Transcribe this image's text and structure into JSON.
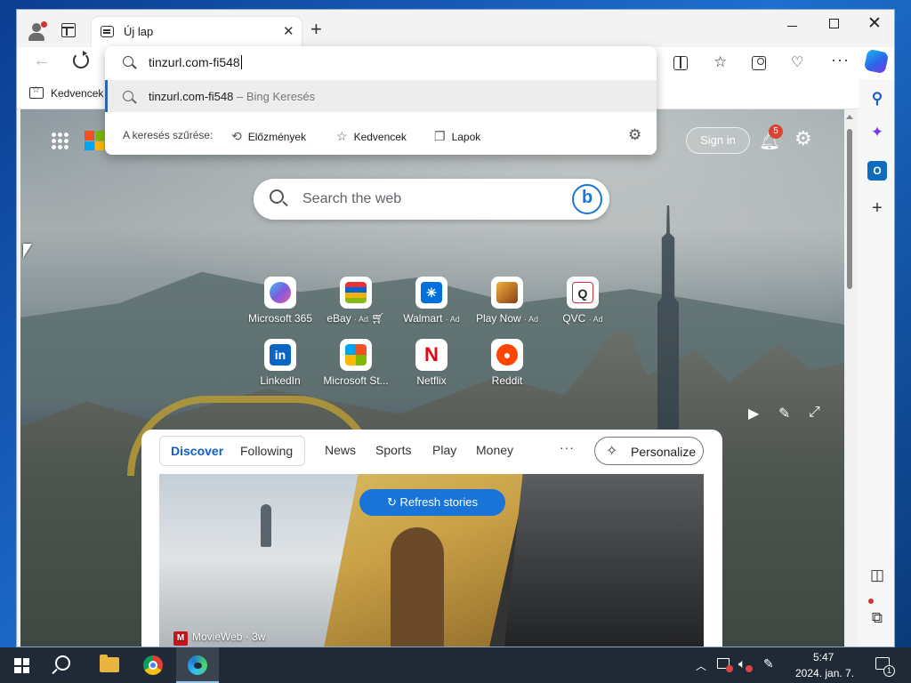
{
  "browser": {
    "tab": {
      "title": "Új lap"
    },
    "favorites_bar": {
      "folder_label": "Kedvencek"
    }
  },
  "omnibox": {
    "input_value": "tinzurl.com-fi548",
    "suggestion": {
      "query": "tinzurl.com-fi548",
      "source": " – Bing Keresés"
    },
    "filter_label": "A keresés szűrése:",
    "filters": [
      "Előzmények",
      "Kedvencek",
      "Lapok"
    ]
  },
  "page": {
    "signin_label": "Sign in",
    "notification_count": "5",
    "search_placeholder": "Search the web",
    "quick_links": [
      {
        "label": "Microsoft 365",
        "ad": "",
        "color": "#7b5be0",
        "glyph": ""
      },
      {
        "label": "eBay",
        "ad": "· Ad",
        "color": "#e53238",
        "glyph": ""
      },
      {
        "label": "Walmart",
        "ad": "· Ad",
        "color": "#0071dc",
        "glyph": "✳"
      },
      {
        "label": "Play Now",
        "ad": "· Ad",
        "color": "#c9792a",
        "glyph": ""
      },
      {
        "label": "QVC",
        "ad": "· Ad",
        "color": "#222222",
        "glyph": "Q"
      },
      {
        "label": "LinkedIn",
        "ad": "",
        "color": "#0a66c2",
        "glyph": "in"
      },
      {
        "label": "Microsoft St...",
        "ad": "",
        "color": "#f25022",
        "glyph": ""
      },
      {
        "label": "Netflix",
        "ad": "",
        "color": "#e50914",
        "glyph": "N"
      },
      {
        "label": "Reddit",
        "ad": "",
        "color": "#ff4500",
        "glyph": "●"
      }
    ],
    "feed": {
      "tabs": [
        "Discover",
        "Following"
      ],
      "nav": [
        "News",
        "Sports",
        "Play",
        "Money"
      ],
      "more": "···",
      "personalize_label": "Personalize",
      "refresh_label": "Refresh stories",
      "source_logo": "M",
      "source": "MovieWeb · 3w"
    }
  },
  "taskbar": {
    "time": "5:47",
    "date": "2024. jan. 7.",
    "notification_count": "1"
  },
  "colors": {
    "accent": "#1a74d8",
    "edge_selection": "#2b63b5",
    "notification_badge": "#d9432f"
  }
}
